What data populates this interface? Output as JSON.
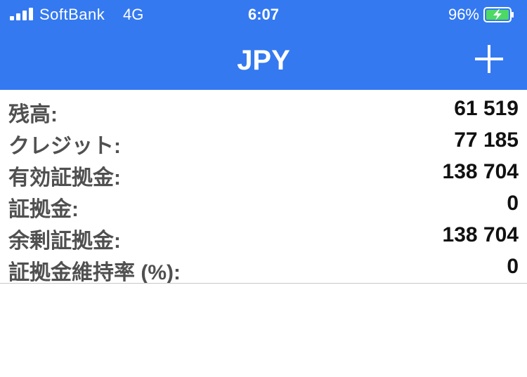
{
  "status_bar": {
    "carrier": "SoftBank",
    "network": "4G",
    "time": "6:07",
    "battery_percent": "96%",
    "battery_icon": "battery-charging-icon",
    "signal_icon": "signal-bars-icon"
  },
  "header": {
    "title": "JPY",
    "add_icon": "plus-icon",
    "background_color": "#3479f0"
  },
  "account": {
    "rows": [
      {
        "label": "残高:",
        "value": "61 519"
      },
      {
        "label": "クレジット:",
        "value": "77 185"
      },
      {
        "label": "有効証拠金:",
        "value": "138 704"
      },
      {
        "label": "証拠金:",
        "value": "0"
      },
      {
        "label": "余剰証拠金:",
        "value": "138 704"
      },
      {
        "label": "証拠金維持率 (%):",
        "value": "0"
      }
    ]
  }
}
